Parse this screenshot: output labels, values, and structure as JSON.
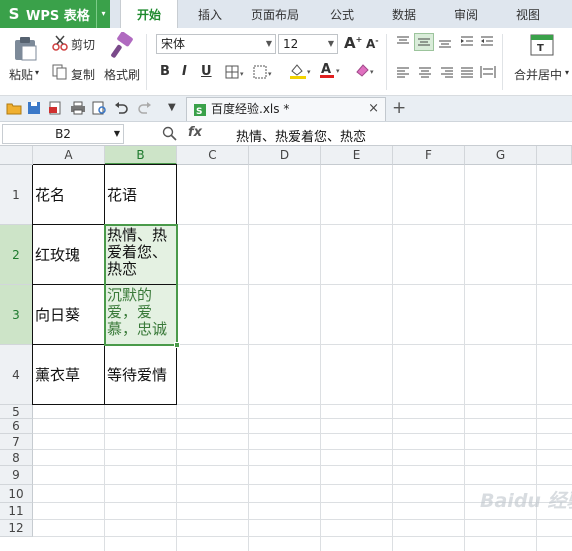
{
  "app": {
    "logo": "S",
    "name": "WPS 表格",
    "menu_arrow": "▾"
  },
  "tabs": [
    "开始",
    "插入",
    "页面布局",
    "公式",
    "数据",
    "审阅",
    "视图"
  ],
  "ribbon": {
    "paste": "粘贴",
    "cut": "剪切",
    "copy": "复制",
    "format_painter": "格式刷",
    "font_name": "宋体",
    "font_size": "12",
    "grow_font": "A",
    "shrink_font": "A",
    "bold": "B",
    "italic": "I",
    "underline": "U",
    "merge_center": "合并居中"
  },
  "document": {
    "tab_title": "百度经验.xls *",
    "close": "×",
    "new_tab": "+"
  },
  "formula_bar": {
    "cell_ref": "B2",
    "fx": "fx",
    "content": "热情、热爱着您、热恋"
  },
  "sheet": {
    "columns": [
      "A",
      "B",
      "C",
      "D",
      "E",
      "F",
      "G"
    ],
    "selected_column": "B",
    "rows": [
      "1",
      "2",
      "3",
      "4",
      "5",
      "6",
      "7",
      "8",
      "9",
      "10",
      "11",
      "12"
    ],
    "selected_rows": [
      "2",
      "3"
    ],
    "cells": {
      "A1": "花名",
      "B1": "花语",
      "A2": "红玫瑰",
      "B2": "热情、热爱着您、热恋",
      "A3": "向日葵",
      "B3": "沉默的爱，爱慕，忠诚",
      "A4": "薰衣草",
      "B4": "等待爱情"
    }
  },
  "watermark": "Baidu 经验",
  "colors": {
    "brand_green": "#3aa14a",
    "active_tab_text": "#1e8a2e",
    "selection_green": "#4a9a4a"
  }
}
